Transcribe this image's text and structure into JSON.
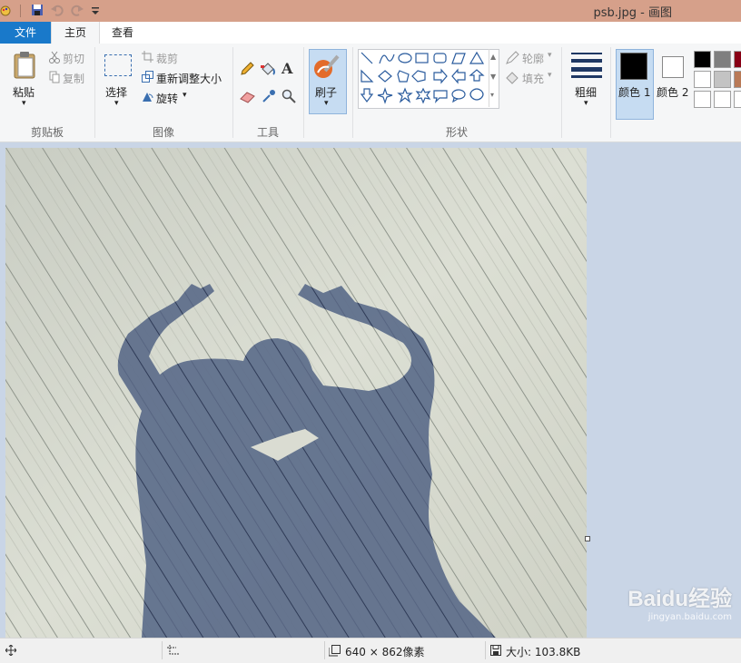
{
  "window": {
    "title": "psb.jpg - 画图"
  },
  "tabs": {
    "file": "文件",
    "home": "主页",
    "view": "查看"
  },
  "clipboard": {
    "paste": "粘贴",
    "cut": "剪切",
    "copy": "复制",
    "label": "剪贴板"
  },
  "image": {
    "select": "选择",
    "crop": "裁剪",
    "resize": "重新调整大小",
    "rotate": "旋转",
    "label": "图像"
  },
  "tools": {
    "label": "工具",
    "text_glyph": "A"
  },
  "brush": {
    "label": "刷子"
  },
  "shapes": {
    "outline": "轮廓",
    "fill": "填充",
    "label": "形状"
  },
  "size": {
    "label": "粗细"
  },
  "colors": {
    "color1_label": "颜色 1",
    "color2_label": "颜色 2",
    "color1": "#000000",
    "color2": "#ffffff",
    "palette": [
      "#000000",
      "#7f7f7f",
      "#880015",
      "#ffffff",
      "#c3c3c3",
      "#b97a57",
      "#ffffff",
      "#ffffff",
      "#ffffff"
    ]
  },
  "status": {
    "dimensions": "640 × 862像素",
    "size": "大小: 103.8KB"
  },
  "watermark": {
    "brand": "Baidu经验",
    "url": "jingyan.baidu.com"
  }
}
